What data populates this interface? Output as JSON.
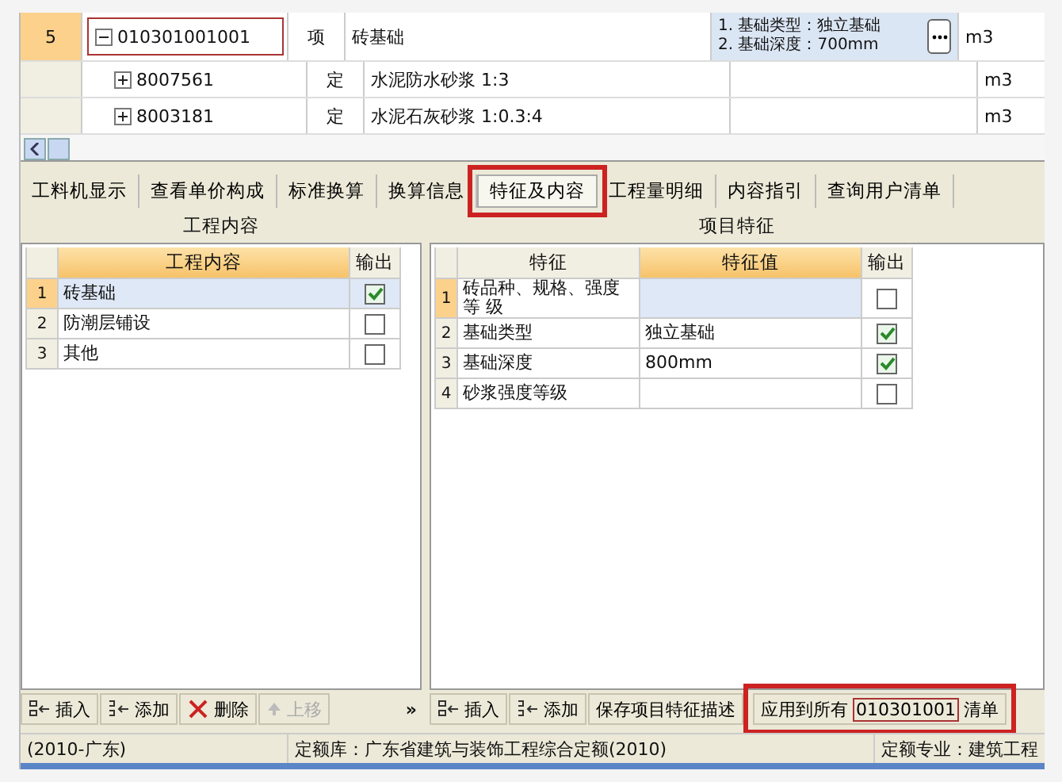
{
  "bill_rows": [
    {
      "number": "5",
      "code": "010301001001",
      "type": "项",
      "name": "砖基础",
      "features": [
        "1. 基础类型：独立基础",
        "2. 基础深度：700mm"
      ],
      "unit": "m3",
      "expanded": true,
      "highlighted": true,
      "children": [
        {
          "code": "8007561",
          "type": "定",
          "name": "水泥防水砂浆 1:3",
          "unit": "m3",
          "expanded": false
        },
        {
          "code": "8003181",
          "type": "定",
          "name": "水泥石灰砂浆 1:0.3:4",
          "unit": "m3",
          "expanded": false
        }
      ]
    }
  ],
  "tabs": [
    {
      "label": "工料机显示",
      "selected": false,
      "highlighted": false
    },
    {
      "label": "查看单价构成",
      "selected": false,
      "highlighted": false
    },
    {
      "label": "标准换算",
      "selected": false,
      "highlighted": false
    },
    {
      "label": "换算信息",
      "selected": false,
      "highlighted": false
    },
    {
      "label": "特征及内容",
      "selected": true,
      "highlighted": true
    },
    {
      "label": "工程量明细",
      "selected": false,
      "highlighted": false
    },
    {
      "label": "内容指引",
      "selected": false,
      "highlighted": false
    },
    {
      "label": "查询用户清单",
      "selected": false,
      "highlighted": false
    }
  ],
  "work_content": {
    "title": "工程内容",
    "columns": [
      "工程内容",
      "输出"
    ],
    "rows": [
      {
        "index": "1",
        "content": "砖基础",
        "checked": true,
        "selected": true
      },
      {
        "index": "2",
        "content": "防潮层铺设",
        "checked": false,
        "selected": false
      },
      {
        "index": "3",
        "content": "其他",
        "checked": false,
        "selected": false
      }
    ],
    "toolbar": [
      {
        "label": "插入",
        "disabled": false
      },
      {
        "label": "添加",
        "disabled": false
      },
      {
        "label": "删除",
        "disabled": false
      },
      {
        "label": "上移",
        "disabled": true
      }
    ],
    "more": "»"
  },
  "item_features": {
    "title": "项目特征",
    "columns": [
      "特征",
      "特征值",
      "输出"
    ],
    "rows": [
      {
        "index": "1",
        "feature": "砖品种、规格、强度等 级",
        "value": "",
        "checked": false,
        "selected": true
      },
      {
        "index": "2",
        "feature": "基础类型",
        "value": "独立基础",
        "checked": true,
        "selected": false
      },
      {
        "index": "3",
        "feature": "基础深度",
        "value": "800mm",
        "checked": true,
        "selected": false
      },
      {
        "index": "4",
        "feature": "砂浆强度等级",
        "value": "",
        "checked": false,
        "selected": false
      }
    ],
    "toolbar": [
      "插入",
      "添加",
      "保存项目特征描述"
    ],
    "apply_button": {
      "prefix": "应用到所有",
      "code": "010301001",
      "suffix": "清单",
      "highlighted": true
    }
  },
  "status_bar": [
    "(2010-广东)",
    "定额库：广东省建筑与装饰工程综合定额(2010)",
    "定额专业：建筑工程"
  ]
}
